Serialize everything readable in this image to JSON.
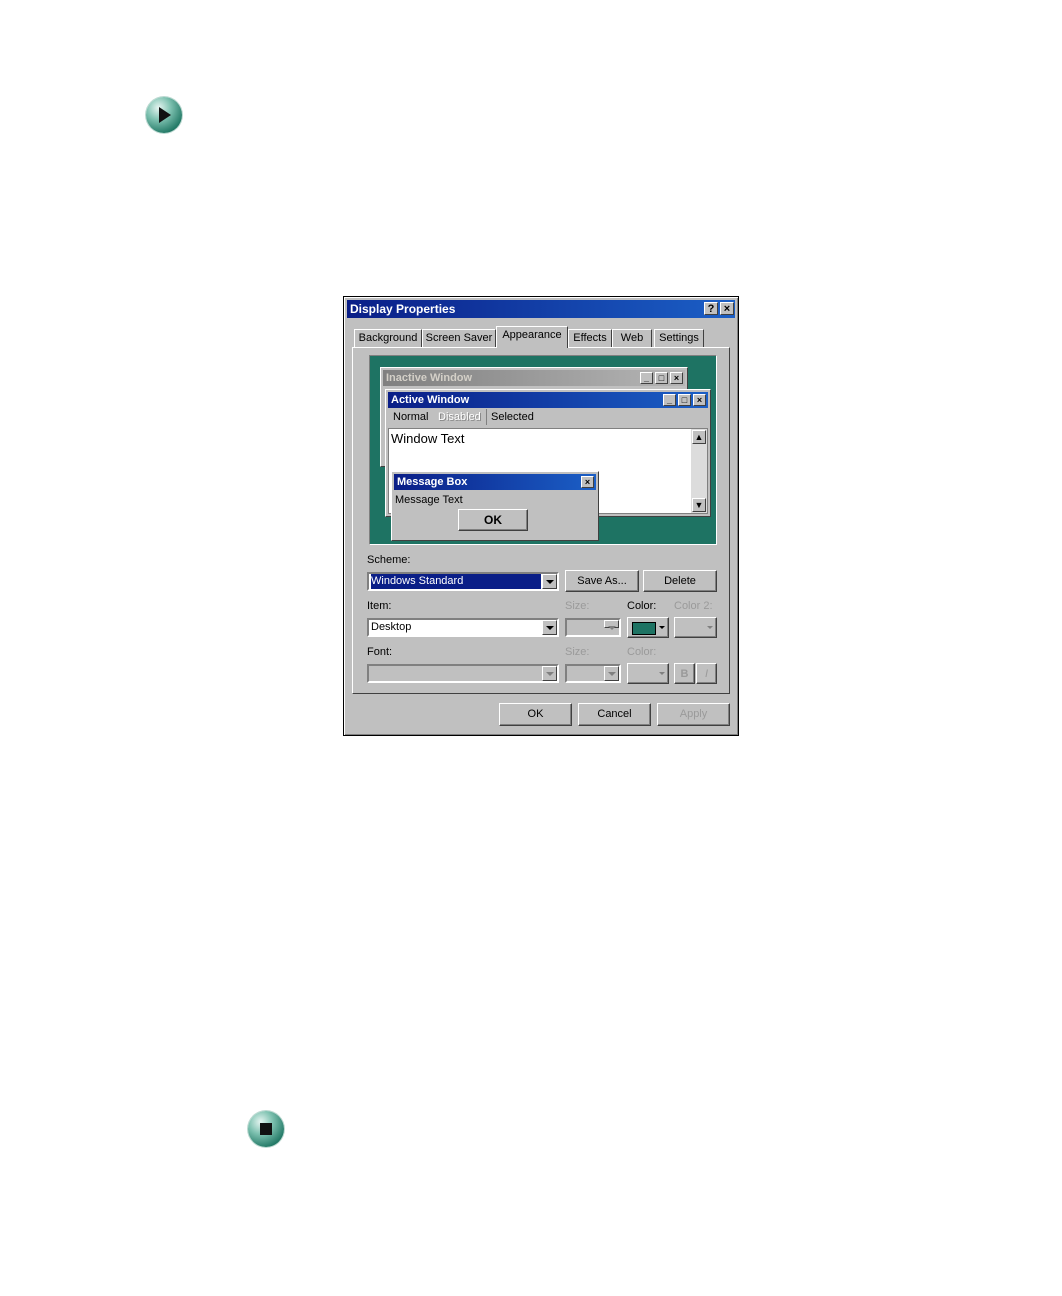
{
  "dialog": {
    "title": "Display Properties",
    "help_btn": "?",
    "close_btn": "×",
    "tabs": [
      {
        "label": "Background"
      },
      {
        "label": "Screen Saver"
      },
      {
        "label": "Appearance"
      },
      {
        "label": "Effects"
      },
      {
        "label": "Web"
      },
      {
        "label": "Settings"
      }
    ],
    "active_tab": "Appearance",
    "preview": {
      "inactive_title": "Inactive Window",
      "active_title": "Active Window",
      "menu": {
        "normal": "Normal",
        "disabled": "Disabled",
        "selected": "Selected"
      },
      "window_text": "Window Text",
      "message_box_title": "Message Box",
      "message_text": "Message Text",
      "ok": "OK",
      "desktop_color": "#1e7363"
    },
    "scheme": {
      "label": "Scheme:",
      "value": "Windows Standard",
      "save_as": "Save As...",
      "delete": "Delete"
    },
    "item": {
      "label": "Item:",
      "value": "Desktop",
      "size_label": "Size:",
      "color_label": "Color:",
      "color2_label": "Color 2:",
      "color_value": "#1e7363"
    },
    "font": {
      "label": "Font:",
      "size_label": "Size:",
      "color_label": "Color:",
      "bold": "B",
      "italic": "I"
    },
    "footer": {
      "ok": "OK",
      "cancel": "Cancel",
      "apply": "Apply"
    }
  },
  "icons": {
    "top": "play-arrow-icon",
    "bottom": "stop-square-icon"
  }
}
